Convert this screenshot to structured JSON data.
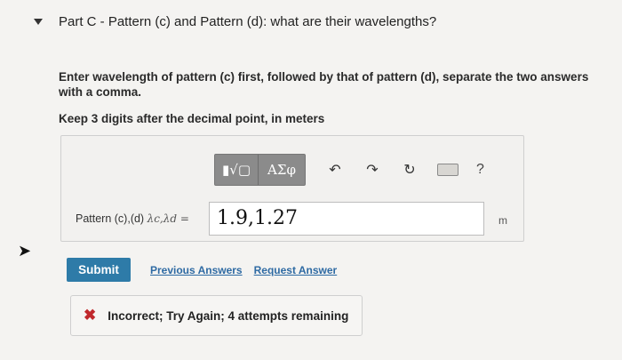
{
  "part": {
    "title": "Part C - Pattern (c) and Pattern (d): what are their wavelengths?",
    "collapse_icon": "caret-down-icon"
  },
  "instructions": {
    "main": "Enter wavelength of pattern (c) first, followed by that of pattern (d), separate the two answers with a comma.",
    "precision": "Keep 3 digits after the decimal point, in meters"
  },
  "toolbar": {
    "template_button": "▮√▢",
    "greek_button": "ΑΣφ",
    "undo_icon": "undo-icon",
    "redo_icon": "redo-icon",
    "reset_icon": "reset-icon",
    "keyboard_icon": "keyboard-icon",
    "help": "?"
  },
  "answer": {
    "label_prefix": "Pattern (c),(d)",
    "symbol": "λc,λd =",
    "value": "1.9,1.27",
    "unit": "m"
  },
  "actions": {
    "submit": "Submit",
    "previous": "Previous Answers",
    "request": "Request Answer"
  },
  "feedback": {
    "icon": "x-icon",
    "text": "Incorrect; Try Again; 4 attempts remaining",
    "color": "#c0282c"
  },
  "colors": {
    "accent": "#2e7ba8",
    "link": "#2e6aa3",
    "toolbar": "#8b8b8b"
  }
}
